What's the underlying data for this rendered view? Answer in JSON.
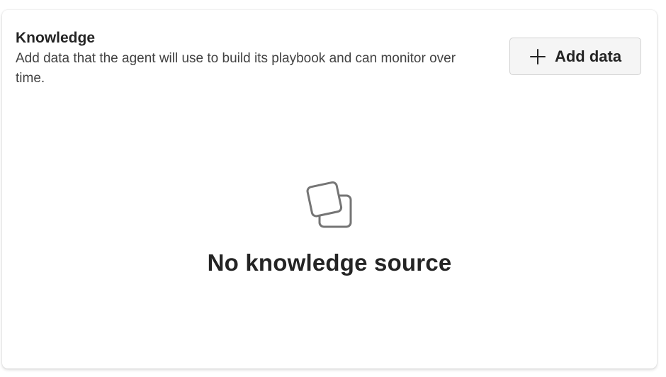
{
  "knowledge": {
    "title": "Knowledge",
    "description": "Add data that the agent will use to build its playbook and can monitor over time.",
    "add_button": {
      "label": "Add data",
      "icon": "plus-icon"
    },
    "empty_state": {
      "icon": "stacked-squares-icon",
      "message": "No knowledge source"
    }
  },
  "colors": {
    "text_primary": "#242424",
    "text_secondary": "#424242",
    "button_background": "#f5f5f5",
    "button_border": "#d1d1d1",
    "icon_stroke": "#616161"
  }
}
